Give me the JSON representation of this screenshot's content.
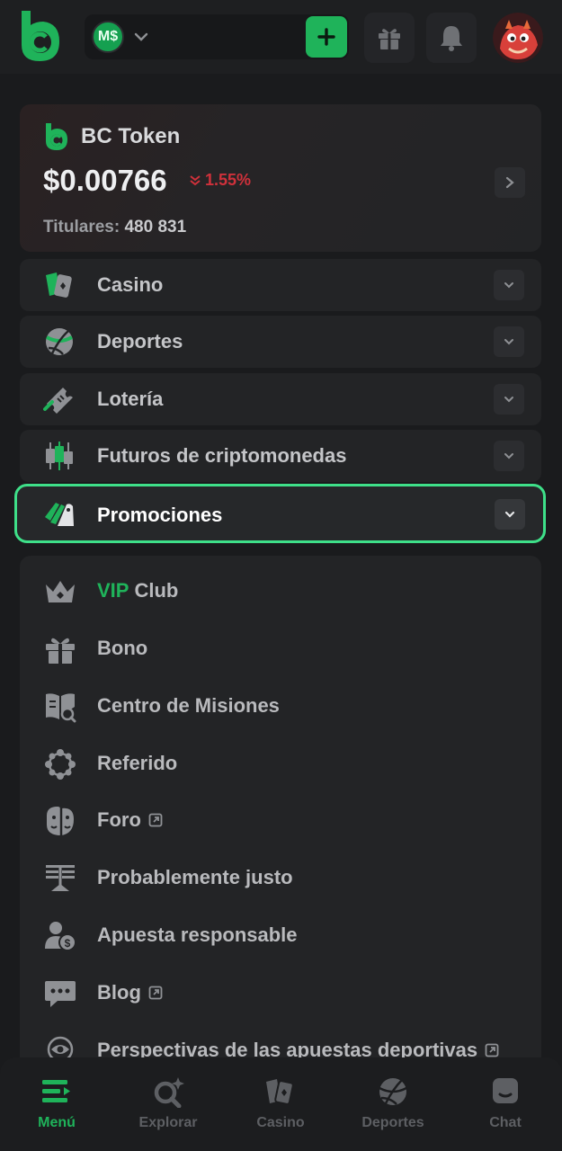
{
  "header": {
    "wallet_currency": "M$"
  },
  "token": {
    "name": "BC Token",
    "price": "$0.00766",
    "change": "1.55%",
    "holders_label": "Titulares:",
    "holders_value": "480 831"
  },
  "menu": {
    "sections": [
      {
        "label": "Casino",
        "icon": "casino-cards-icon"
      },
      {
        "label": "Deportes",
        "icon": "basketball-icon"
      },
      {
        "label": "Lotería",
        "icon": "lottery-ticket-icon"
      },
      {
        "label": "Futuros de criptomonedas",
        "icon": "candlestick-chart-icon"
      },
      {
        "label": "Promociones",
        "icon": "promo-tags-icon",
        "selected": true
      }
    ],
    "links": [
      {
        "label_accent": "VIP",
        "label": "Club",
        "icon": "crown-icon"
      },
      {
        "label": "Bono",
        "icon": "gift-icon"
      },
      {
        "label": "Centro de Misiones",
        "icon": "mission-book-icon"
      },
      {
        "label": "Referido",
        "icon": "referral-circle-icon"
      },
      {
        "label": "Foro",
        "icon": "forum-faces-icon",
        "external": true
      },
      {
        "label": "Probablemente justo",
        "icon": "scale-icon"
      },
      {
        "label": "Apuesta responsable",
        "icon": "responsible-user-icon"
      },
      {
        "label": "Blog",
        "icon": "chat-bubble-icon",
        "external": true
      },
      {
        "label": "Perspectivas de las apuestas deportivas",
        "icon": "insight-eye-icon",
        "external": true
      }
    ]
  },
  "bottom_nav": {
    "items": [
      {
        "label": "Menú",
        "icon": "menu-icon",
        "active": true
      },
      {
        "label": "Explorar",
        "icon": "explore-search-icon"
      },
      {
        "label": "Casino",
        "icon": "casino-cards-icon"
      },
      {
        "label": "Deportes",
        "icon": "basketball-icon"
      },
      {
        "label": "Chat",
        "icon": "chat-icon"
      }
    ]
  },
  "colors": {
    "background": "#1a1b1d",
    "card": "#232426",
    "accent_green": "#1fb35a",
    "highlight_border": "#3ee089",
    "negative_red": "#d0313b"
  }
}
